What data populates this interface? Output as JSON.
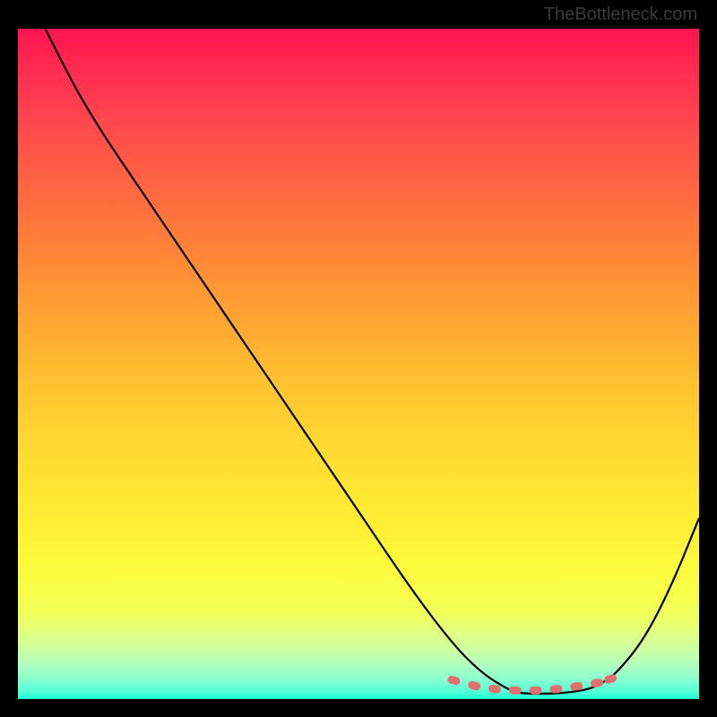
{
  "watermark": "TheBottleneck.com",
  "chart_data": {
    "type": "line",
    "title": "",
    "xlabel": "",
    "ylabel": "",
    "xlim": [
      0,
      100
    ],
    "ylim": [
      0,
      100
    ],
    "series": [
      {
        "name": "curve",
        "x": [
          4,
          10,
          20,
          30,
          40,
          50,
          58,
          64,
          68,
          71,
          73,
          75,
          78,
          81,
          84,
          86,
          88,
          92,
          96,
          100
        ],
        "y": [
          100,
          88,
          73,
          58,
          43,
          28,
          16,
          8,
          4,
          2,
          1,
          0.8,
          0.8,
          1,
          1.5,
          2.5,
          4,
          9,
          17,
          27
        ]
      }
    ],
    "dotted_segment": {
      "x": [
        64,
        67,
        70,
        73,
        76,
        79,
        82,
        85,
        87
      ],
      "y": [
        2.8,
        2.0,
        1.5,
        1.3,
        1.3,
        1.5,
        1.9,
        2.4,
        3.0
      ]
    },
    "colors": {
      "line": "#000000",
      "dots": "#e07070",
      "gradient_top": "#ff1450",
      "gradient_bottom": "#18ffd0"
    }
  }
}
